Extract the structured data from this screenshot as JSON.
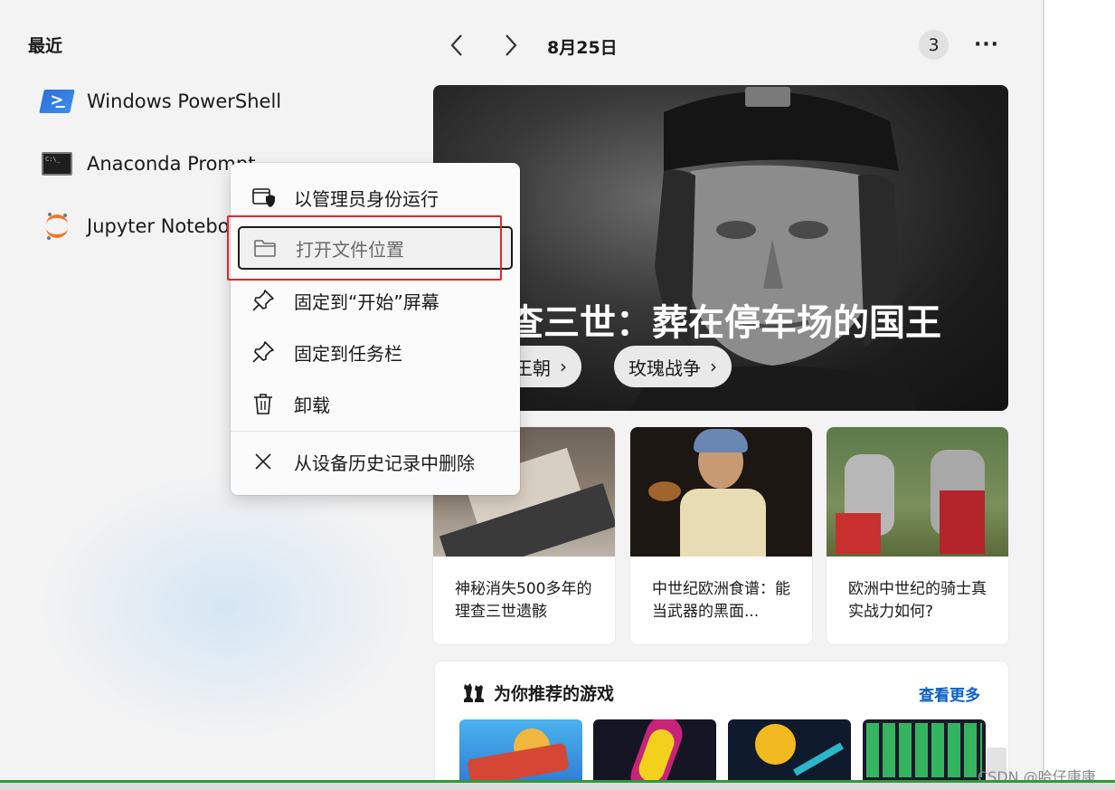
{
  "recent": {
    "title": "最近",
    "apps": [
      {
        "name": "Windows PowerShell",
        "icon": "powershell-icon"
      },
      {
        "name": "Anaconda Prompt",
        "icon": "terminal-icon"
      },
      {
        "name": "Jupyter Notebook",
        "icon": "jupyter-icon"
      }
    ]
  },
  "header": {
    "back_icon": "chevron-left-icon",
    "forward_icon": "chevron-right-icon",
    "date": "8月25日",
    "badge": "3",
    "more": "···"
  },
  "hero": {
    "title": "查三世：葬在停车场的国王",
    "tags": [
      {
        "label": "花王朝"
      },
      {
        "label": "玫瑰战争"
      }
    ]
  },
  "news": [
    {
      "caption": "神秘消失500多年的理查三世遗骸"
    },
    {
      "caption": "中世纪欧洲食谱：能当武器的黑面..."
    },
    {
      "caption": "欧洲中世纪的骑士真实战力如何?"
    }
  ],
  "games": {
    "title": "为你推荐的游戏",
    "see_more": "查看更多"
  },
  "context_menu": {
    "items": [
      {
        "label": "以管理员身份运行",
        "icon": "shield-admin-icon"
      },
      {
        "label": "打开文件位置",
        "icon": "folder-icon"
      },
      {
        "label": "固定到“开始”屏幕",
        "icon": "pin-icon"
      },
      {
        "label": "固定到任务栏",
        "icon": "pin-icon"
      },
      {
        "label": "卸载",
        "icon": "trash-icon"
      },
      {
        "label": "从设备历史记录中删除",
        "icon": "close-icon"
      }
    ]
  },
  "watermark": "CSDN @哈仔康康",
  "colors": {
    "accent_link": "#0a5fc4",
    "highlight_box": "#e0262b",
    "taskbar_line": "#2f9a3a"
  }
}
